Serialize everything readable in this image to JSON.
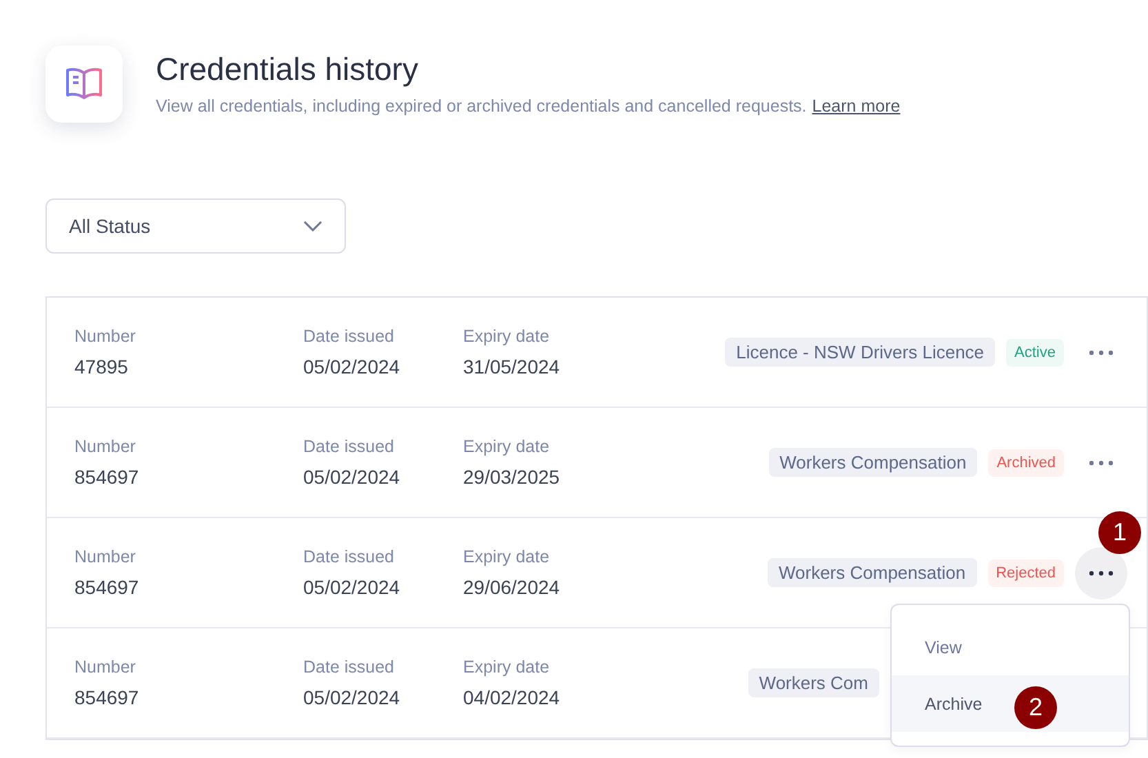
{
  "header": {
    "title": "Credentials history",
    "description": "View all credentials, including expired or archived credentials and cancelled requests.",
    "link": "Learn more"
  },
  "filter": {
    "value": "All Status"
  },
  "rows": [
    {
      "number_label": "Number",
      "number": "47895",
      "issued_label": "Date issued",
      "issued": "05/02/2024",
      "expiry_label": "Expiry date",
      "expiry": "31/05/2024",
      "type": "Licence - NSW Drivers Licence",
      "status": "Active",
      "color": "#20a37f",
      "menu_open": false
    },
    {
      "number_label": "Number",
      "number": "854697",
      "issued_label": "Date issued",
      "issued": "05/02/2024",
      "expiry_label": "Expiry date",
      "expiry": "29/03/2025",
      "type": "Workers Compensation",
      "status": "Archived",
      "color": "#ef5350",
      "menu_open": false
    },
    {
      "number_label": "Number",
      "number": "854697",
      "issued_label": "Date issued",
      "issued": "05/02/2024",
      "expiry_label": "Expiry date",
      "expiry": "29/06/2024",
      "type": "Workers Compensation",
      "status": "Rejected",
      "color": "#ef5350",
      "menu_open": true
    },
    {
      "number_label": "Number",
      "number": "854697",
      "issued_label": "Date issued",
      "issued": "05/02/2024",
      "expiry_label": "Expiry date",
      "expiry": "04/02/2024",
      "type": "Workers Com"
    }
  ],
  "menu": {
    "items": [
      {
        "label": "View",
        "selected": false
      },
      {
        "label": "Archive",
        "selected": true
      }
    ]
  },
  "callouts": [
    "1",
    "2"
  ]
}
